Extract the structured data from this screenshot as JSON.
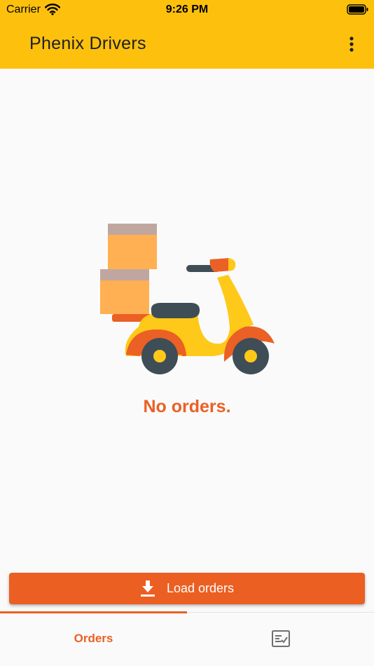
{
  "status_bar": {
    "carrier": "Carrier",
    "time": "9:26 PM",
    "icons": [
      "wifi-icon",
      "battery-icon"
    ]
  },
  "app_bar": {
    "title": "Phenix Drivers",
    "menu_icon": "more-vert-icon"
  },
  "empty_state": {
    "illustration": "delivery-scooter-illustration",
    "message": "No orders."
  },
  "actions": {
    "load_orders_label": "Load orders",
    "load_orders_icon": "download-icon"
  },
  "bottom_nav": {
    "tabs": [
      {
        "label": "Orders",
        "selected": true
      },
      {
        "icon": "checklist-icon",
        "selected": false
      }
    ]
  },
  "colors": {
    "app_bar": "#fdc10d",
    "accent": "#eb6024",
    "background": "#fafafa"
  }
}
